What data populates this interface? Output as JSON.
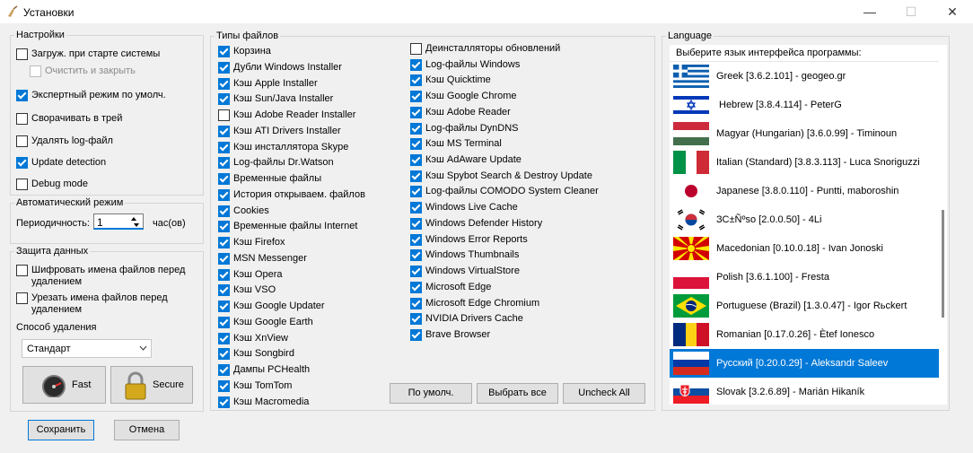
{
  "window": {
    "title": "Установки",
    "minimize": "—",
    "maximize": "☐",
    "close": "✕"
  },
  "settings": {
    "title": "Настройки",
    "items": [
      {
        "label": "Загруж. при старте системы",
        "checked": false
      },
      {
        "label": "Очистить и закрыть",
        "checked": false,
        "disabled": true
      },
      {
        "label": "Экспертный режим по умолч.",
        "checked": true
      },
      {
        "label": "Сворачивать в трей",
        "checked": false
      },
      {
        "label": "Удалять log-файл",
        "checked": false
      },
      {
        "label": "Update detection",
        "checked": true
      },
      {
        "label": "Debug mode",
        "checked": false
      }
    ]
  },
  "auto": {
    "title": "Автоматический режим",
    "period_label": "Периодичность:",
    "period_value": "1",
    "unit": "час(ов)"
  },
  "protect": {
    "title": "Защита данных",
    "items": [
      {
        "label": "Шифровать имена файлов перед удалением",
        "checked": false
      },
      {
        "label": "Урезать имена файлов перед удалением",
        "checked": false
      }
    ],
    "method_label": "Способ удаления",
    "method_value": "Стандарт",
    "fast": "Fast",
    "secure": "Secure"
  },
  "filetypes": {
    "title": "Типы файлов",
    "col1": [
      {
        "label": "Корзина",
        "checked": true
      },
      {
        "label": "Дубли Windows Installer",
        "checked": true
      },
      {
        "label": "Кэш Apple Installer",
        "checked": true
      },
      {
        "label": "Кэш Sun/Java Installer",
        "checked": true
      },
      {
        "label": "Кэш Adobe Reader Installer",
        "checked": false
      },
      {
        "label": "Кэш ATI Drivers Installer",
        "checked": true
      },
      {
        "label": "Кэш инсталлятора Skype",
        "checked": true
      },
      {
        "label": "Log-файлы Dr.Watson",
        "checked": true
      },
      {
        "label": "Временные файлы",
        "checked": true
      },
      {
        "label": "История открываем. файлов",
        "checked": true
      },
      {
        "label": "Cookies",
        "checked": true
      },
      {
        "label": "Временные файлы Internet",
        "checked": true
      },
      {
        "label": "Кэш Firefox",
        "checked": true
      },
      {
        "label": "MSN Messenger",
        "checked": true
      },
      {
        "label": "Кэш Opera",
        "checked": true
      },
      {
        "label": "Кэш VSO",
        "checked": true
      },
      {
        "label": "Кэш Google Updater",
        "checked": true
      },
      {
        "label": "Кэш Google Earth",
        "checked": true
      },
      {
        "label": "Кэш XnView",
        "checked": true
      },
      {
        "label": "Кэш Songbird",
        "checked": true
      },
      {
        "label": "Дампы PCHealth",
        "checked": true
      },
      {
        "label": "Кэш TomTom",
        "checked": true
      },
      {
        "label": "Кэш Macromedia",
        "checked": true
      }
    ],
    "col2": [
      {
        "label": "Деинсталляторы обновлений",
        "checked": false
      },
      {
        "label": "Log-файлы Windows",
        "checked": true
      },
      {
        "label": "Кэш Quicktime",
        "checked": true
      },
      {
        "label": "Кэш Google Chrome",
        "checked": true
      },
      {
        "label": "Кэш Adobe Reader",
        "checked": true
      },
      {
        "label": "Log-файлы DynDNS",
        "checked": true
      },
      {
        "label": "Кэш MS Terminal",
        "checked": true
      },
      {
        "label": "Кэш AdAware Update",
        "checked": true
      },
      {
        "label": "Кэш Spybot Search & Destroy Update",
        "checked": true
      },
      {
        "label": "Log-файлы COMODO System Cleaner",
        "checked": true
      },
      {
        "label": "Windows Live Cache",
        "checked": true
      },
      {
        "label": "Windows Defender History",
        "checked": true
      },
      {
        "label": "Windows Error Reports",
        "checked": true
      },
      {
        "label": "Windows Thumbnails",
        "checked": true
      },
      {
        "label": "Windows VirtualStore",
        "checked": true
      },
      {
        "label": "Microsoft Edge",
        "checked": true
      },
      {
        "label": "Microsoft Edge Chromium",
        "checked": true
      },
      {
        "label": "NVIDIA Drivers Cache",
        "checked": true
      },
      {
        "label": "Brave Browser",
        "checked": true
      }
    ],
    "btn_default": "По умолч.",
    "btn_select_all": "Выбрать все",
    "btn_uncheck_all": "Uncheck All"
  },
  "language": {
    "title": "Language",
    "header": "Выберите язык интерфейса программы:",
    "items": [
      {
        "label": "Greek [3.6.2.101] - geogeo.gr",
        "flag": "greece"
      },
      {
        "label": "Hebrew [3.8.4.114] - PeterG",
        "flag": "israel"
      },
      {
        "label": "Magyar (Hungarian) [3.6.0.99] - Timinoun",
        "flag": "hungary"
      },
      {
        "label": "Italian (Standard) [3.8.3.113] - Luca Snoriguzzi",
        "flag": "italy"
      },
      {
        "label": "Japanese [3.8.0.110] - Puntti, maboroshin",
        "flag": "japan"
      },
      {
        "label": "ЗС±Ñºso [2.0.0.50] - 4Li",
        "flag": "korea"
      },
      {
        "label": "Macedonian [0.10.0.18] - Ivan Jonoski",
        "flag": "macedonia"
      },
      {
        "label": "Polish [3.6.1.100] - Fresta",
        "flag": "poland"
      },
      {
        "label": "Portuguese (Brazil) [1.3.0.47] - Igor Rьckert",
        "flag": "brazil"
      },
      {
        "label": "Romanian [0.17.0.26] - Ètef Ionesco",
        "flag": "romania"
      },
      {
        "label": "Русский [0.20.0.29] - Aleksandr Saleev",
        "flag": "russia",
        "selected": true
      },
      {
        "label": "Slovak [3.2.6.89] - Marián Hikaník",
        "flag": "slovakia"
      }
    ]
  },
  "footer": {
    "save": "Сохранить",
    "cancel": "Отмена"
  },
  "colors": {
    "accent": "#0078d7"
  }
}
